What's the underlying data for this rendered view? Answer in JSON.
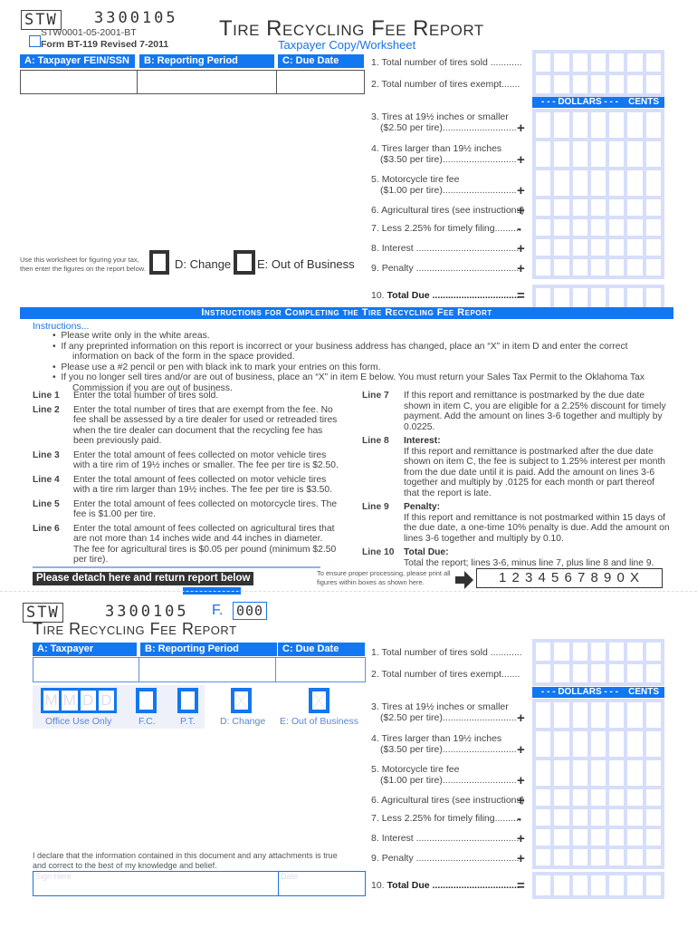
{
  "top": {
    "stw": "STW",
    "account_code": "3300105",
    "form_code": "STW0001-05-2001-BT",
    "form_id": "Form BT-119  Revised 7-2011",
    "title": "Tire Recycling Fee Report",
    "subtitle": "Taxpayer Copy/Worksheet",
    "headers": {
      "a": "A:  Taxpayer FEIN/SSN",
      "b": "B:  Reporting Period",
      "c": "C:  Due Date"
    },
    "worksheet_note_1": "Use this worksheet for figuring your tax,",
    "worksheet_note_2": "then enter the figures on the report below.",
    "d_change": "D: Change",
    "e_out": "E: Out of Business"
  },
  "lines": [
    {
      "num": "1.",
      "text": "Total number of tires sold ............",
      "sub": "",
      "op": ""
    },
    {
      "num": "2.",
      "text": "Total number of tires exempt.......",
      "sub": "",
      "op": ""
    },
    {
      "num": "3.",
      "text": "Tires at 19½ inches or smaller",
      "sub": "($2.50 per tire)............................",
      "op": "+"
    },
    {
      "num": "4.",
      "text": "Tires larger than 19½ inches",
      "sub": "($3.50 per tire)............................",
      "op": "+"
    },
    {
      "num": "5.",
      "text": "Motorcycle tire fee",
      "sub": "($1.00 per tire)............................",
      "op": "+"
    },
    {
      "num": "6.",
      "text": "Agricultural tires (see instructions)",
      "sub": "",
      "op": "+"
    },
    {
      "num": "7.",
      "text": "Less 2.25% for timely filing..........",
      "sub": "",
      "op": "-"
    },
    {
      "num": "8.",
      "text": "Interest .......................................",
      "sub": "",
      "op": "+"
    },
    {
      "num": "9.",
      "text": "Penalty .......................................",
      "sub": "",
      "op": "+"
    },
    {
      "num": "10.",
      "text": "Total Due .................................",
      "sub": "",
      "op": "="
    }
  ],
  "money_header": {
    "dollars": "- - - DOLLARS - - -",
    "cents": "CENTS"
  },
  "instructions": {
    "banner": "Instructions for Completing the Tire Recycling Fee Report",
    "heading": "Instructions...",
    "bullets": [
      "Please write only in the white areas.",
      "If any preprinted information on this report is incorrect or your business address has changed, place an “X” in item D and enter the correct",
      "information on back of the form in the space provided.",
      "Please use a #2 pencil or pen with black ink to mark your entries on this form.",
      "If you no longer sell tires and/or are out of business, place an “X” in item E below. You must return your Sales Tax Permit to the Oklahoma Tax",
      "Commission if you are out of business."
    ],
    "left": [
      {
        "label": "Line 1",
        "text": "Enter the total number of tires sold."
      },
      {
        "label": "Line 2",
        "text": "Enter the total number of tires that are exempt from the fee. No fee shall be assessed by a tire dealer for used or retreaded tires when the tire dealer can document that the recycling fee has been previously paid."
      },
      {
        "label": "Line 3",
        "text": "Enter the total amount of fees collected on motor vehicle tires with a tire rim of 19½  inches or smaller.  The fee per tire is $2.50."
      },
      {
        "label": "Line 4",
        "text": "Enter the total amount of fees collected on motor vehicle tires with a tire rim larger than 19½ inches. The fee per tire is $3.50."
      },
      {
        "label": "Line 5",
        "text": "Enter the total amount of fees collected on motorcycle tires. The fee is $1.00 per tire."
      },
      {
        "label": "Line 6",
        "text": "Enter the total amount of fees collected on agricultural tires that are not more than 14 inches wide and 44 inches in diameter. The fee for agricultural tires is $0.05 per pound (minimum $2.50 per tire)."
      }
    ],
    "right": [
      {
        "label": "Line 7",
        "title": "",
        "text": "If this report and remittance is postmarked by the due date shown in item C, you are eligible for a 2.25% discount for timely payment. Add the amount on lines 3-6 together and multiply by 0.0225."
      },
      {
        "label": "Line 8",
        "title": "Interest:",
        "text": "If this report and remittance is postmarked after the due date shown on item C, the fee is subject to 1.25% interest per month from the due date until it is paid. Add the amount on lines 3-6 together and multiply by .0125 for each month or part thereof that the report is late."
      },
      {
        "label": "Line 9",
        "title": "Penalty:",
        "text": "If this report and remittance is not postmarked within 15 days of the due date, a one-time 10% penalty is due. Add the amount on lines 3-6 together and multiply by 0.10."
      },
      {
        "label": "Line 10",
        "title": "Total Due:",
        "text": "Total the report; lines 3-6, minus line 7, plus line 8 and line 9."
      }
    ]
  },
  "detach": {
    "label": "Please detach here and return report below",
    "note_1": "To ensure proper processing, please print all",
    "note_2": "figures within boxes as shown here.",
    "sample": "1 2 3 4 5 6 7 8 9 0 X"
  },
  "bottom": {
    "stw": "STW",
    "account_code": "3300105",
    "f_label": "F.",
    "f_value": "000",
    "title": "Tire Recycling Fee Report",
    "office_use": "Office Use Only",
    "mmdd": [
      "M",
      "M",
      "D",
      "D"
    ],
    "fc": "F.C.",
    "pt": "P.T.",
    "d_change": "D: Change",
    "e_out": "E: Out of Business",
    "declaration_1": "I declare that the information contained in this document and any attachments is true",
    "declaration_2": "and correct to the best of my knowledge and belief.",
    "sign_placeholder": "Sign Here",
    "date_placeholder": "Date"
  }
}
